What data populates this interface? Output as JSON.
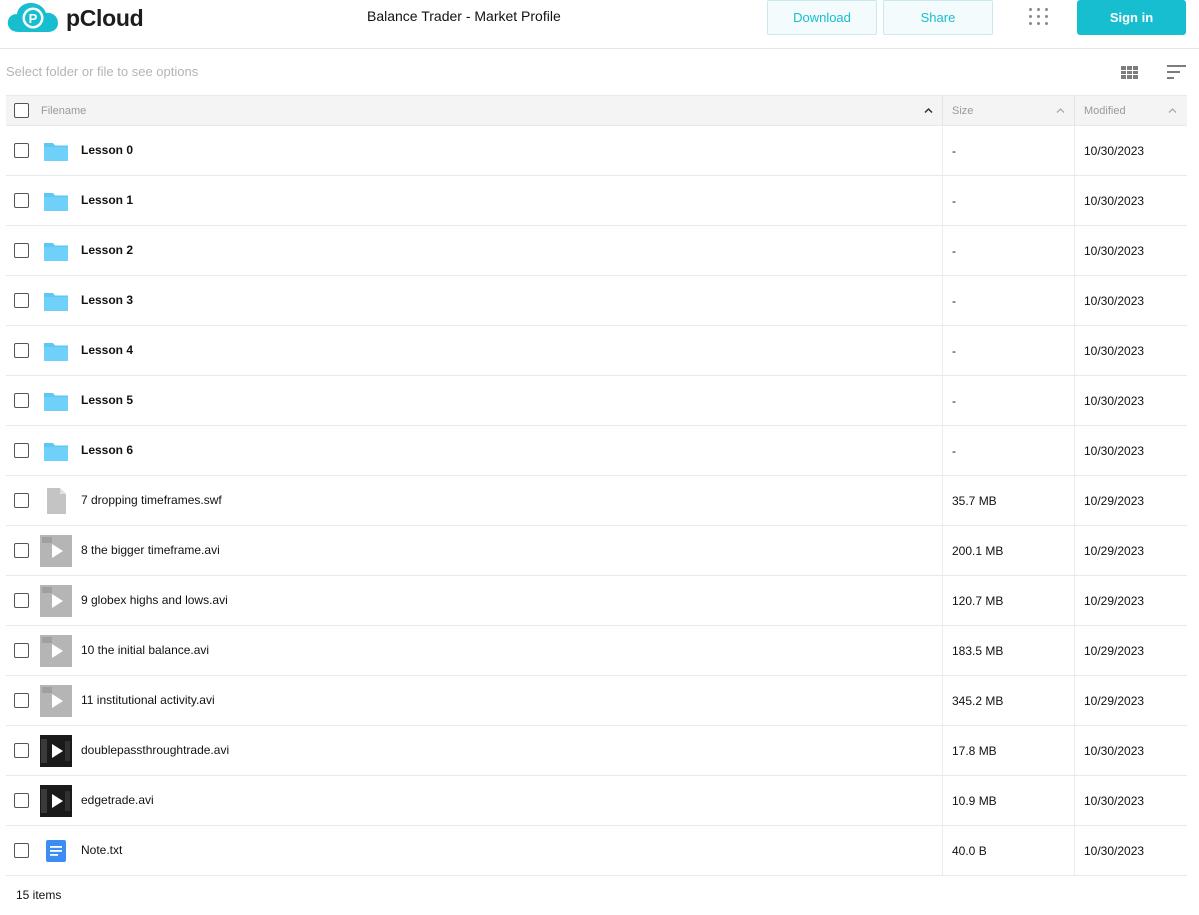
{
  "header": {
    "brand": "pCloud",
    "title": "Balance Trader - Market Profile",
    "download_label": "Download",
    "share_label": "Share",
    "signin_label": "Sign in",
    "accent_color": "#17bed0"
  },
  "toolbar": {
    "hint": "Select folder or file to see options",
    "grid_view_icon": "grid-view-icon",
    "sort_icon": "sort-lines-icon"
  },
  "columns": {
    "filename": "Filename",
    "size": "Size",
    "modified": "Modified"
  },
  "files": [
    {
      "name": "Lesson 0",
      "size": "-",
      "modified": "10/30/2023",
      "kind": "folder"
    },
    {
      "name": "Lesson 1",
      "size": "-",
      "modified": "10/30/2023",
      "kind": "folder"
    },
    {
      "name": "Lesson 2",
      "size": "-",
      "modified": "10/30/2023",
      "kind": "folder"
    },
    {
      "name": "Lesson 3",
      "size": "-",
      "modified": "10/30/2023",
      "kind": "folder"
    },
    {
      "name": "Lesson 4",
      "size": "-",
      "modified": "10/30/2023",
      "kind": "folder"
    },
    {
      "name": "Lesson 5",
      "size": "-",
      "modified": "10/30/2023",
      "kind": "folder"
    },
    {
      "name": "Lesson 6",
      "size": "-",
      "modified": "10/30/2023",
      "kind": "folder"
    },
    {
      "name": "7 dropping timeframes.swf",
      "size": "35.7 MB",
      "modified": "10/29/2023",
      "kind": "file"
    },
    {
      "name": "8 the bigger timeframe.avi",
      "size": "200.1 MB",
      "modified": "10/29/2023",
      "kind": "video-light"
    },
    {
      "name": "9 globex highs and lows.avi",
      "size": "120.7 MB",
      "modified": "10/29/2023",
      "kind": "video-light"
    },
    {
      "name": "10 the initial balance.avi",
      "size": "183.5 MB",
      "modified": "10/29/2023",
      "kind": "video-light"
    },
    {
      "name": "11 institutional activity.avi",
      "size": "345.2 MB",
      "modified": "10/29/2023",
      "kind": "video-light"
    },
    {
      "name": "doublepassthroughtrade.avi",
      "size": "17.8 MB",
      "modified": "10/30/2023",
      "kind": "video-dark"
    },
    {
      "name": "edgetrade.avi",
      "size": "10.9 MB",
      "modified": "10/30/2023",
      "kind": "video-dark"
    },
    {
      "name": "Note.txt",
      "size": "40.0 B",
      "modified": "10/30/2023",
      "kind": "text"
    }
  ],
  "footer": {
    "count": "15 items"
  }
}
